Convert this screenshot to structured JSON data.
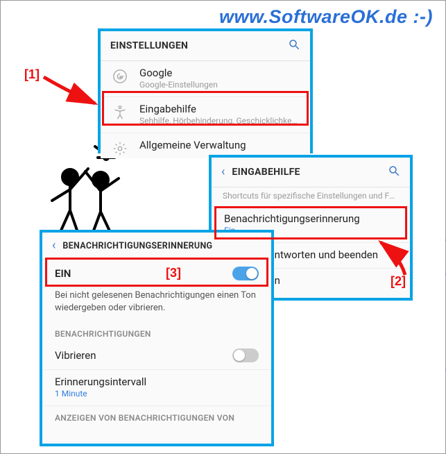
{
  "watermark": "www.SoftwareOK.de :-)",
  "labels": {
    "n1": "[1]",
    "n2": "[2]",
    "n3": "[3]"
  },
  "panel1": {
    "title": "EINSTELLUNGEN",
    "items": [
      {
        "title": "Google",
        "sub": "Google-Einstellungen"
      },
      {
        "title": "Eingabehilfe",
        "sub": "Sehhilfe, Hörbehinderung, Geschicklichkeit..."
      },
      {
        "title": "Allgemeine Verwaltung",
        "sub": ""
      }
    ]
  },
  "panel2": {
    "title": "EINGABEHILFE",
    "hint": "Shortcuts für spezifische Einstellungen und Funktionen hinzufügen.",
    "items": [
      {
        "title": "Benachrichtigungserinnerung",
        "sub": "Ein"
      },
      {
        "title": "Anrufe beantworten und beenden",
        "sub": ""
      },
      {
        "title": "ches Tippen",
        "sub": ""
      }
    ]
  },
  "panel3": {
    "title": "BENACHRICHTIGUNGSERINNERUNG",
    "switch_label": "EIN",
    "desc": "Bei nicht gelesenen Benachrichtigungen einen Ton wiedergeben oder vibrieren.",
    "section1": "BENACHRICHTIGUNGEN",
    "vibrate": "Vibrieren",
    "interval_label": "Erinnerungsintervall",
    "interval_value": "1 Minute",
    "section2": "ANZEIGEN VON BENACHRICHTIGUNGEN VON"
  }
}
